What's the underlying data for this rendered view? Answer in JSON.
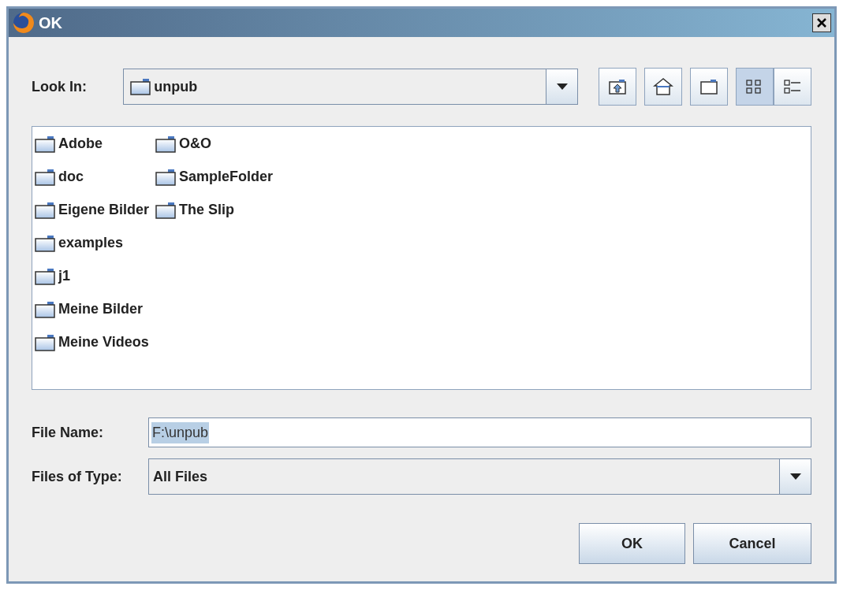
{
  "window": {
    "title": "OK"
  },
  "look_in": {
    "label": "Look In:",
    "value": "unpub"
  },
  "toolbar": [
    {
      "kind": "up",
      "selected": false
    },
    {
      "kind": "home",
      "selected": false
    },
    {
      "kind": "new-folder",
      "selected": false
    },
    {
      "kind": "list",
      "selected": true
    },
    {
      "kind": "details",
      "selected": false
    }
  ],
  "files": [
    {
      "name": "Adobe"
    },
    {
      "name": "doc"
    },
    {
      "name": "Eigene Bilder"
    },
    {
      "name": "examples"
    },
    {
      "name": "j1"
    },
    {
      "name": "Meine Bilder"
    },
    {
      "name": "Meine Videos"
    },
    {
      "name": "O&O"
    },
    {
      "name": "SampleFolder"
    },
    {
      "name": "The Slip"
    }
  ],
  "file_name": {
    "label": "File Name:",
    "value": "F:\\unpub",
    "value_selected": true
  },
  "file_type": {
    "label": "Files of Type:",
    "value": "All Files"
  },
  "buttons": [
    {
      "label": "OK"
    },
    {
      "label": "Cancel"
    }
  ]
}
